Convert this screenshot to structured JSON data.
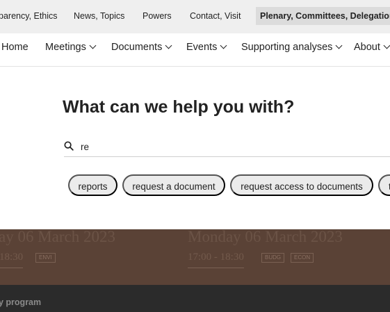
{
  "top_nav": {
    "items": [
      "parency, Ethics",
      "News, Topics",
      "Powers",
      "Contact, Visit",
      "Plenary, Committees, Delegations"
    ]
  },
  "main_nav": {
    "items": [
      "Home",
      "Meetings",
      "Documents",
      "Events",
      "Supporting analyses",
      "About"
    ]
  },
  "search": {
    "title": "What can we help you with?",
    "query": "re",
    "suggestions": [
      "reports",
      "request a document",
      "request access to documents",
      "t"
    ]
  },
  "events": [
    {
      "date": "ay 06 March 2023",
      "time": "18:30",
      "tags": [
        "ENVI"
      ]
    },
    {
      "date": "Monday 06 March 2023",
      "time": "17:00 - 18:30",
      "tags": [
        "BUDG",
        "ECON"
      ]
    }
  ],
  "program": {
    "label": "y program"
  },
  "colors": {
    "events_band": "#5a4236",
    "program_bar": "#2b2b2b",
    "chip_bg": "#ebebeb",
    "top_nav_bg": "#efefef"
  }
}
